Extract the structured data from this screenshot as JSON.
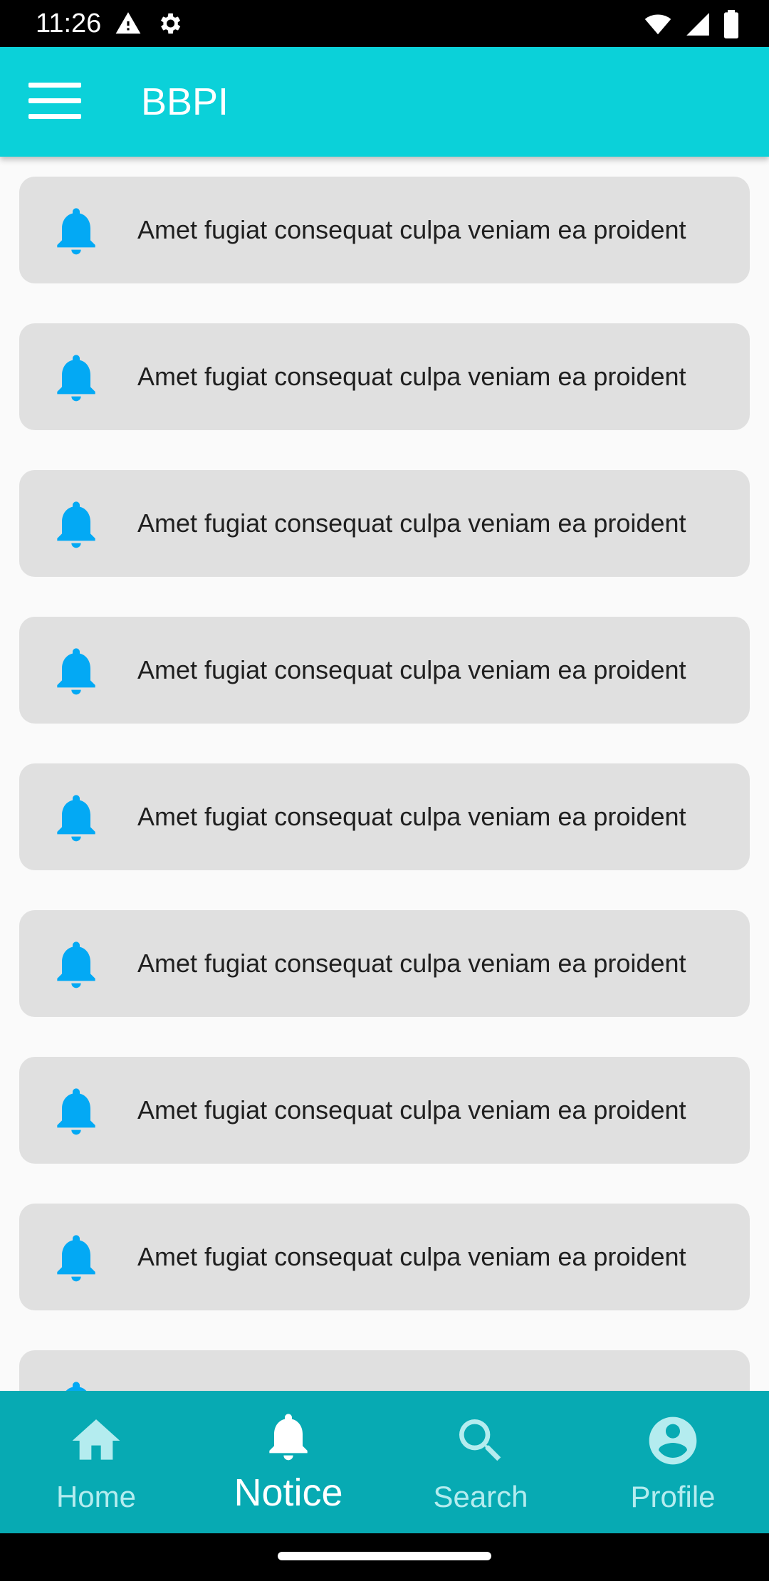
{
  "status_bar": {
    "time": "11:26",
    "left_icons": [
      "warning-icon",
      "settings-icon"
    ],
    "right_icons": [
      "wifi-icon",
      "signal-icon",
      "battery-icon"
    ]
  },
  "app_bar": {
    "title": "BBPI",
    "menu_icon": "hamburger-menu-icon"
  },
  "notices": [
    {
      "icon": "bell-icon",
      "text": "Amet fugiat consequat culpa veniam ea proident"
    },
    {
      "icon": "bell-icon",
      "text": "Amet fugiat consequat culpa veniam ea proident"
    },
    {
      "icon": "bell-icon",
      "text": "Amet fugiat consequat culpa veniam ea proident"
    },
    {
      "icon": "bell-icon",
      "text": "Amet fugiat consequat culpa veniam ea proident"
    },
    {
      "icon": "bell-icon",
      "text": "Amet fugiat consequat culpa veniam ea proident"
    },
    {
      "icon": "bell-icon",
      "text": "Amet fugiat consequat culpa veniam ea proident"
    },
    {
      "icon": "bell-icon",
      "text": "Amet fugiat consequat culpa veniam ea proident"
    },
    {
      "icon": "bell-icon",
      "text": "Amet fugiat consequat culpa veniam ea proident"
    },
    {
      "icon": "bell-icon",
      "text": ""
    }
  ],
  "bottom_nav": [
    {
      "label": "Home",
      "icon": "home-icon",
      "active": false
    },
    {
      "label": "Notice",
      "icon": "bell-icon",
      "active": true
    },
    {
      "label": "Search",
      "icon": "search-icon",
      "active": false
    },
    {
      "label": "Profile",
      "icon": "account-circle-icon",
      "active": false
    }
  ],
  "colors": {
    "app_bar": "#0bd1d9",
    "bottom_nav": "#07aab3",
    "bell": "#03a9f4",
    "card": "#e0e0e0",
    "inactive_nav": "#b4ecef"
  }
}
